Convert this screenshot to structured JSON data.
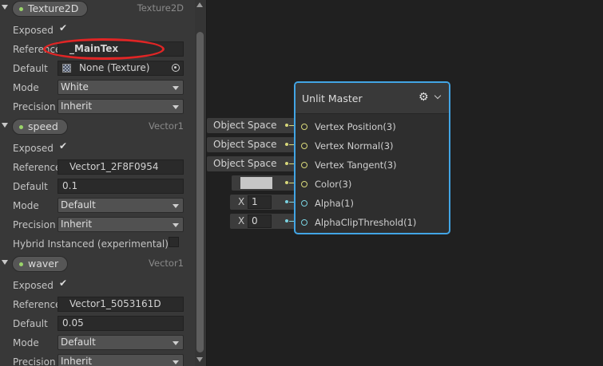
{
  "blackboard": {
    "properties": [
      {
        "name": "Texture2D",
        "type": "Texture2D",
        "exposed_label": "Exposed",
        "exposed": true,
        "reference_label": "Reference",
        "reference": "_MainTex",
        "default_label": "Default",
        "default": "None (Texture)",
        "mode_label": "Mode",
        "mode": "White",
        "precision_label": "Precision",
        "precision": "Inherit"
      },
      {
        "name": "speed",
        "type": "Vector1",
        "exposed_label": "Exposed",
        "exposed": true,
        "reference_label": "Reference",
        "reference": "Vector1_2F8F0954",
        "default_label": "Default",
        "default": "0.1",
        "mode_label": "Mode",
        "mode": "Default",
        "precision_label": "Precision",
        "precision": "Inherit",
        "hybrid_label": "Hybrid Instanced (experimental)"
      },
      {
        "name": "waver",
        "type": "Vector1",
        "exposed_label": "Exposed",
        "exposed": true,
        "reference_label": "Reference",
        "reference": "Vector1_5053161D",
        "default_label": "Default",
        "default": "0.05",
        "mode_label": "Mode",
        "mode": "Default",
        "precision_label": "Precision",
        "precision": "Inherit"
      }
    ]
  },
  "graph": {
    "inputs": [
      {
        "text": "Object Space"
      },
      {
        "text": "Object Space"
      },
      {
        "text": "Object Space"
      },
      {
        "kind": "color",
        "color": "#c6c6c6"
      },
      {
        "axis": "X",
        "value": "1"
      },
      {
        "axis": "X",
        "value": "0"
      }
    ],
    "master_node": {
      "title": "Unlit Master",
      "ports": [
        "Vertex Position(3)",
        "Vertex Normal(3)",
        "Vertex Tangent(3)",
        "Color(3)",
        "Alpha(1)",
        "AlphaClipThreshold(1)"
      ]
    }
  },
  "colors": {
    "selection_border": "#42a5e5",
    "vector3_port": "#d7d77a",
    "vector1_port": "#7ad2e0",
    "annotation_ring": "#e02525",
    "exposed_dot": "#9ad46a"
  },
  "icons": {
    "check": "✔",
    "gear": "⚙"
  }
}
